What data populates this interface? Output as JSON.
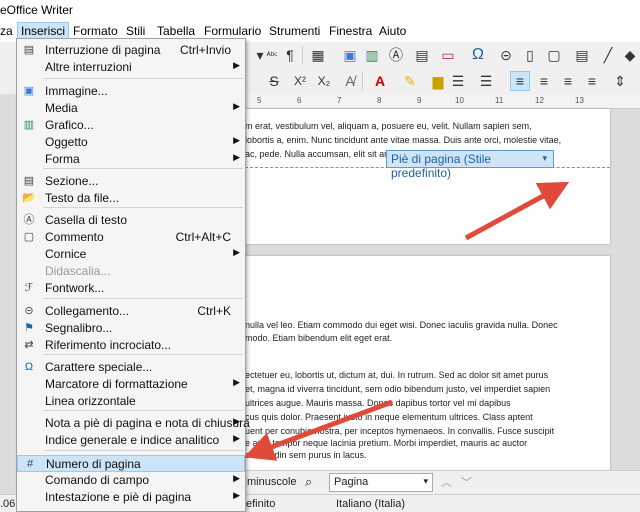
{
  "window": {
    "title": "eOffice Writer"
  },
  "menubar": {
    "items": [
      "za",
      "Inserisci",
      "Formato",
      "Stili",
      "Tabella",
      "Formulario",
      "Strumenti",
      "Finestra",
      "Aiuto"
    ]
  },
  "insert_menu": {
    "items": [
      {
        "label": "Interruzione di pagina",
        "shortcut": "Ctrl+Invio",
        "icon": "page-break-icon"
      },
      {
        "label": "Altre interruzioni",
        "submenu": true
      },
      {
        "label": "Immagine...",
        "icon": "image-icon"
      },
      {
        "label": "Media",
        "submenu": true
      },
      {
        "label": "Grafico...",
        "icon": "chart-icon"
      },
      {
        "label": "Oggetto",
        "submenu": true
      },
      {
        "label": "Forma",
        "submenu": true
      },
      {
        "label": "Sezione...",
        "icon": "section-icon"
      },
      {
        "label": "Testo da file...",
        "icon": "folder-icon"
      },
      {
        "label": "Casella di testo",
        "icon": "textbox-icon"
      },
      {
        "label": "Commento",
        "shortcut": "Ctrl+Alt+C",
        "icon": "comment-icon"
      },
      {
        "label": "Cornice",
        "submenu": true
      },
      {
        "label": "Didascalia...",
        "disabled": true
      },
      {
        "label": "Fontwork...",
        "icon": "fontwork-icon"
      },
      {
        "label": "Collegamento...",
        "shortcut": "Ctrl+K",
        "icon": "hyperlink-icon"
      },
      {
        "label": "Segnalibro...",
        "icon": "bookmark-icon"
      },
      {
        "label": "Riferimento incrociato...",
        "icon": "cross-reference-icon"
      },
      {
        "label": "Carattere speciale...",
        "icon": "omega-icon"
      },
      {
        "label": "Marcatore di formattazione",
        "submenu": true
      },
      {
        "label": "Linea orizzontale"
      },
      {
        "label": "Nota a piè di pagina e nota di chiusura",
        "submenu": true
      },
      {
        "label": "Indice generale e indice analitico",
        "submenu": true
      },
      {
        "label": "Numero di pagina",
        "icon": "page-number-icon",
        "selected": true
      },
      {
        "label": "Comando di campo",
        "submenu": true
      },
      {
        "label": "Intestazione e piè di pagina",
        "submenu": true
      }
    ]
  },
  "document": {
    "footer_label": "Piè di pagina (Stile predefinito)",
    "page1_lines": [
      "m erat, vestibulum vel, aliquam a, posuere eu, velit. Nullam sapien sem,",
      "lobortis a, enim. Nunc tincidunt ante vitae massa. Duis ante orci, molestie vitae,",
      "ac, pede. Nulla accumsan, elit sit ar"
    ],
    "page2_lines": [
      "nulla vel leo. Etiam commodo dui eget wisi. Donec iaculis gravida nulla. Donec",
      "modo. Etiam bibendum elit eget erat.",
      "",
      "ectetuer eu, lobortis ut, dictum at, dui. In rutrum. Sed ac dolor sit amet purus",
      "et, magna id viverra tincidunt, sem odio bibendum justo, vel imperdiet sapien",
      "ultrices augue. Mauris massa. Donec dapibus tortor vel mi dapibus",
      "cus quis dolor. Praesent justo in neque elementum ultrices. Class aptent",
      "uent per conubia nostra, per inceptos hymenaeos. In convallis. Fusce suscipit",
      "e arcu tempor neque lacinia pretium. Morbi imperdiet, mauris ac auctor",
      "sollicitudin sem purus in lacus."
    ]
  },
  "ruler": {
    "numbers": [
      "5",
      "6",
      "7",
      "8",
      "9",
      "10",
      "11",
      "12",
      "13"
    ]
  },
  "findbar": {
    "match_case_label": "minuscole",
    "navigate_by": "Pagina"
  },
  "statusbar": {
    "left": ".06",
    "style": "efinito",
    "language": "Italiano (Italia)"
  },
  "colors": {
    "accent": "#cce4f7",
    "arrow": "#e04a3a",
    "footer_border": "#5b9bd5"
  }
}
